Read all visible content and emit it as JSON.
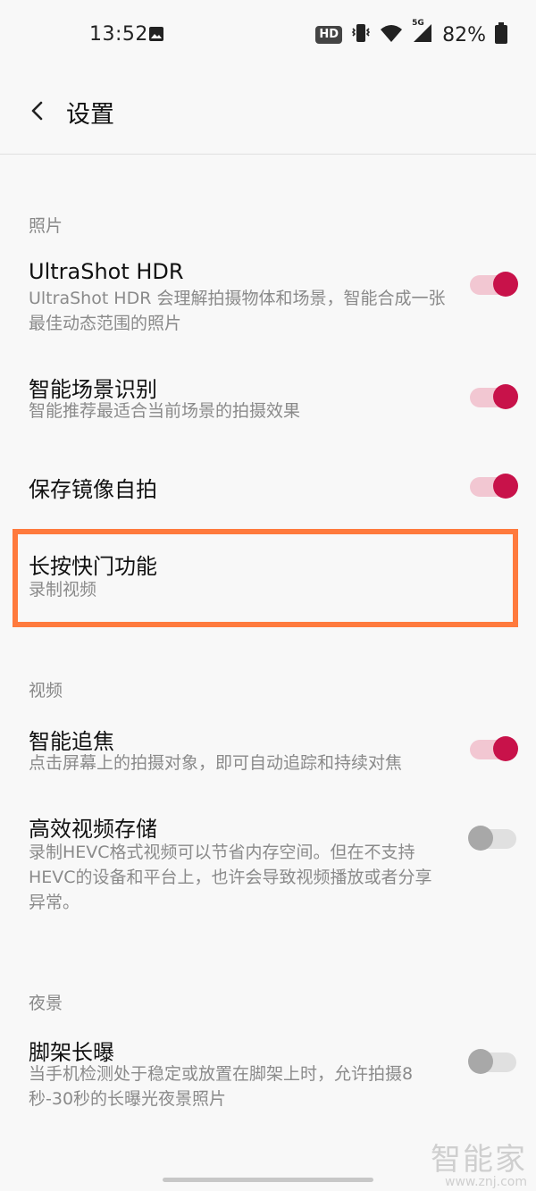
{
  "status_bar": {
    "time": "13:52",
    "hd": "HD",
    "network": "5G",
    "battery": "82%",
    "icons": [
      "image-icon",
      "vibrate-icon",
      "wifi-icon",
      "signal-icon",
      "battery-icon"
    ]
  },
  "appbar": {
    "title": "设置"
  },
  "sections": {
    "photo": {
      "header": "照片"
    },
    "video": {
      "header": "视频"
    },
    "night": {
      "header": "夜景"
    }
  },
  "settings": {
    "ultrashot_hdr": {
      "title": "UltraShot HDR",
      "subtitle": "UltraShot HDR 会理解拍摄物体和场景，智能合成一张最佳动态范围的照片",
      "enabled": true
    },
    "scene_recognition": {
      "title": "智能场景识别",
      "subtitle": "智能推荐最适合当前场景的拍摄效果",
      "enabled": true
    },
    "mirror_selfie": {
      "title": "保存镜像自拍",
      "enabled": true
    },
    "long_press_shutter": {
      "title": "长按快门功能",
      "subtitle": "录制视频"
    },
    "smart_tracking": {
      "title": "智能追焦",
      "subtitle": "点击屏幕上的拍摄对象，即可自动追踪和持续对焦",
      "enabled": true
    },
    "hevc_storage": {
      "title": "高效视频存储",
      "subtitle": "录制HEVC格式视频可以节省内存空间。但在不支持HEVC的设备和平台上，也许会导致视频播放或者分享异常。",
      "enabled": false
    },
    "tripod_long_exposure": {
      "title": "脚架长曝",
      "subtitle": "当手机检测处于稳定或放置在脚架上时，允许拍摄8秒-30秒的长曝光夜景照片",
      "enabled": false
    }
  },
  "watermark": {
    "brand": "智能家",
    "url": "www.znj.com"
  },
  "colors": {
    "accent": "#c8124a",
    "accent_track": "#f2c7d2",
    "highlight": "#ff7a3d"
  }
}
